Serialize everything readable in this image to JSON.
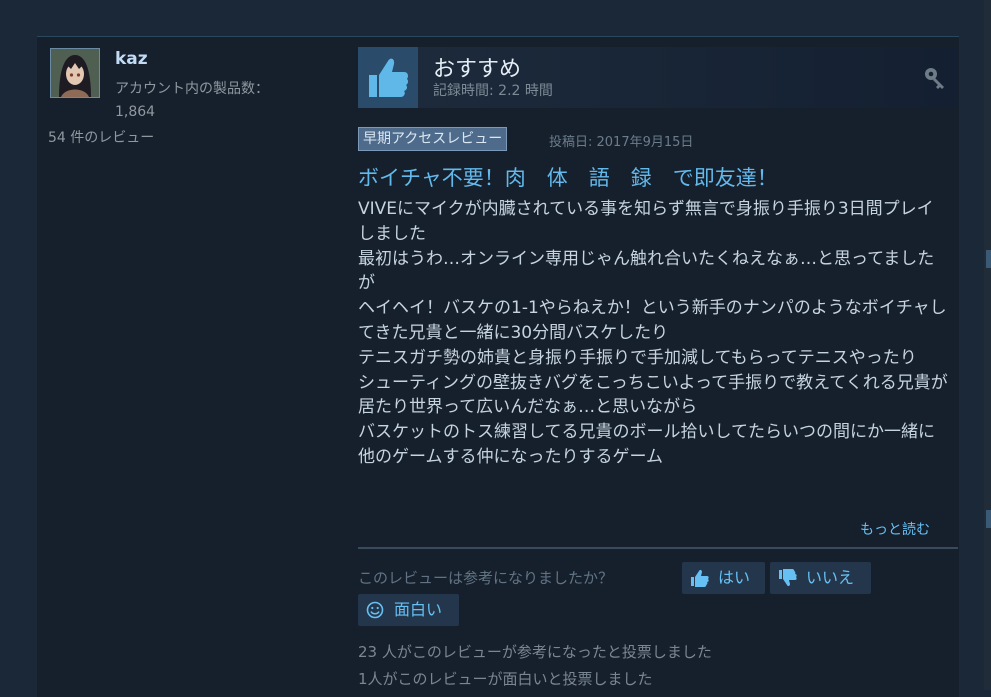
{
  "reviewer": {
    "name": "kaz",
    "products_label": "アカウント内の製品数：",
    "products_count": "1,864",
    "review_count": "54 件のレビュー"
  },
  "header": {
    "recommendation": "おすすめ",
    "playtime": "記録時間: 2.2 時間",
    "icon": "thumbs-up-icon",
    "owner_icon": "key-icon"
  },
  "badge": "早期アクセスレビュー",
  "posted": "投稿日: 2017年9月15日",
  "review": {
    "title": "ボイチャ不要！肉　体　語　録　で即友達！",
    "lines": [
      "VIVEにマイクが内臓されている事を知らず無言で身振り手振り3日間プレイしました",
      "最初はうわ…オンライン専用じゃん触れ合いたくねえなぁ…と思ってましたが",
      "ヘイヘイ！バスケの1-1やらねえか！という新手のナンパのようなボイチャしてきた兄貴と一緒に30分間バスケしたり",
      "テニスガチ勢の姉貴と身振り手振りで手加減してもらってテニスやったり",
      "シューティングの壁抜きバグをこっちこいよって手振りで教えてくれる兄貴が居たり世界って広いんだなぁ…と思いながら",
      "バスケットのトス練習してる兄貴のボール拾いしてたらいつの間にか一緒に他のゲームする仲になったりするゲーム"
    ],
    "read_more": "もっと読む"
  },
  "helpful": {
    "question": "このレビューは参考になりましたか？",
    "yes": "はい",
    "no": "いいえ",
    "funny": "面白い"
  },
  "stats": {
    "helpful": "23 人がこのレビューが参考になったと投票しました",
    "funny": "1人がこのレビューが面白いと投票しました"
  },
  "colors": {
    "page_bg": "#1b2838",
    "card_bg": "#16202d",
    "title_blue": "#62b9ec",
    "link_blue": "#66c0f4",
    "body_text": "#c6d4df",
    "muted_text": "#8f98a0"
  }
}
